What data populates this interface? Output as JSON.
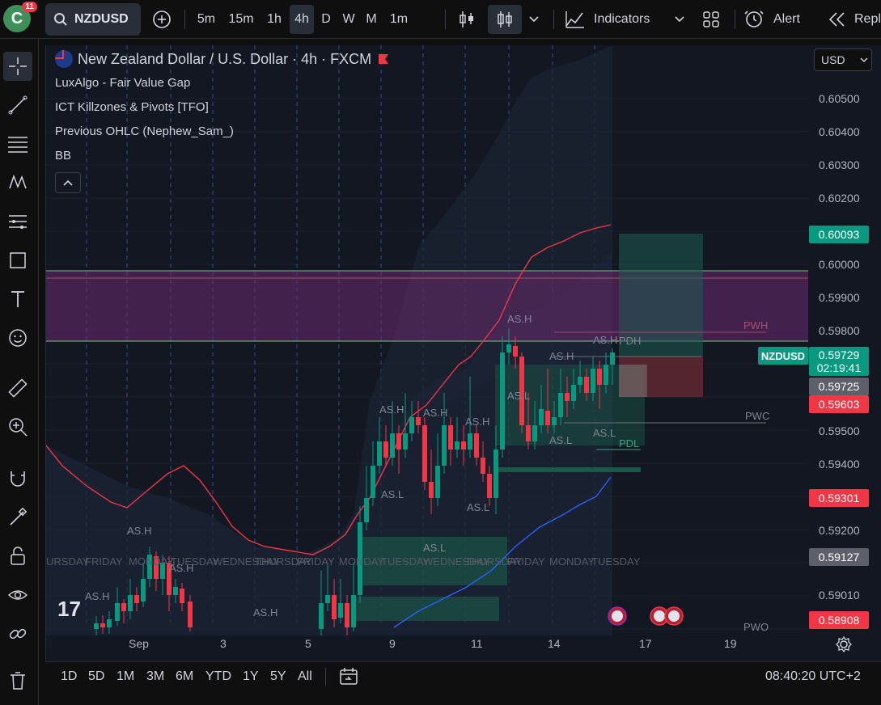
{
  "header": {
    "avatar_letter": "C",
    "notification_count": "11",
    "symbol": "NZDUSD",
    "intervals": [
      "5m",
      "15m",
      "1h",
      "4h",
      "D",
      "W",
      "M",
      "1m"
    ],
    "active_interval": "4h",
    "indicators_label": "Indicators",
    "alert_label": "Alert",
    "replay_label": "Repl"
  },
  "legend": {
    "title": "New Zealand Dollar / U.S. Dollar · 4h · FXCM",
    "indicators": [
      "LuxAlgo - Fair Value Gap",
      "ICT Killzones & Pivots [TFO]",
      "Previous OHLC (Nephew_Sam_)",
      "BB"
    ]
  },
  "price_axis": {
    "currency": "USD",
    "ticks": [
      "0.60500",
      "0.60400",
      "0.60300",
      "0.60200",
      "0.60000",
      "0.59900",
      "0.59800",
      "0.59500",
      "0.59400",
      "0.59200",
      "0.59010"
    ],
    "tags": {
      "upper": "0.60093",
      "current": "0.59729",
      "countdown": "02:19:41",
      "gray1": "0.59725",
      "red1": "0.59603",
      "red2": "0.59301",
      "gray2": "0.59127",
      "red3": "0.58908"
    },
    "symbol_tag": "NZDUSD"
  },
  "chart_labels": {
    "pwh": "PWH",
    "pdh": "PDH",
    "pwc": "PWC",
    "pdl": "PDL",
    "pwo": "PWO",
    "as_h": "AS.H",
    "as_l": "AS.L",
    "days": [
      "URSDAY",
      "FRIDAY",
      "MONDAY",
      "TUESDAY",
      "WEDNESDAY",
      "THURSDAY",
      "FRIDAY",
      "MONDAY",
      "TUESDAY",
      "WEDNESDAY",
      "THURSDAY",
      "FRIDAY",
      "MONDAY",
      "TUESDAY"
    ]
  },
  "time_axis": {
    "labels": [
      "Sep",
      "3",
      "5",
      "9",
      "11",
      "14",
      "17",
      "19"
    ]
  },
  "bottom": {
    "ranges": [
      "1D",
      "5D",
      "1M",
      "3M",
      "6M",
      "YTD",
      "1Y",
      "5Y",
      "All"
    ],
    "clock": "08:40:20 UTC+2"
  },
  "colors": {
    "up": "#089981",
    "down": "#f23645",
    "bb_upper": "#f23645",
    "bb_lower": "#2962ff",
    "fvg_purple": "#6a2c70",
    "fvg_green": "#1b5e4a"
  }
}
